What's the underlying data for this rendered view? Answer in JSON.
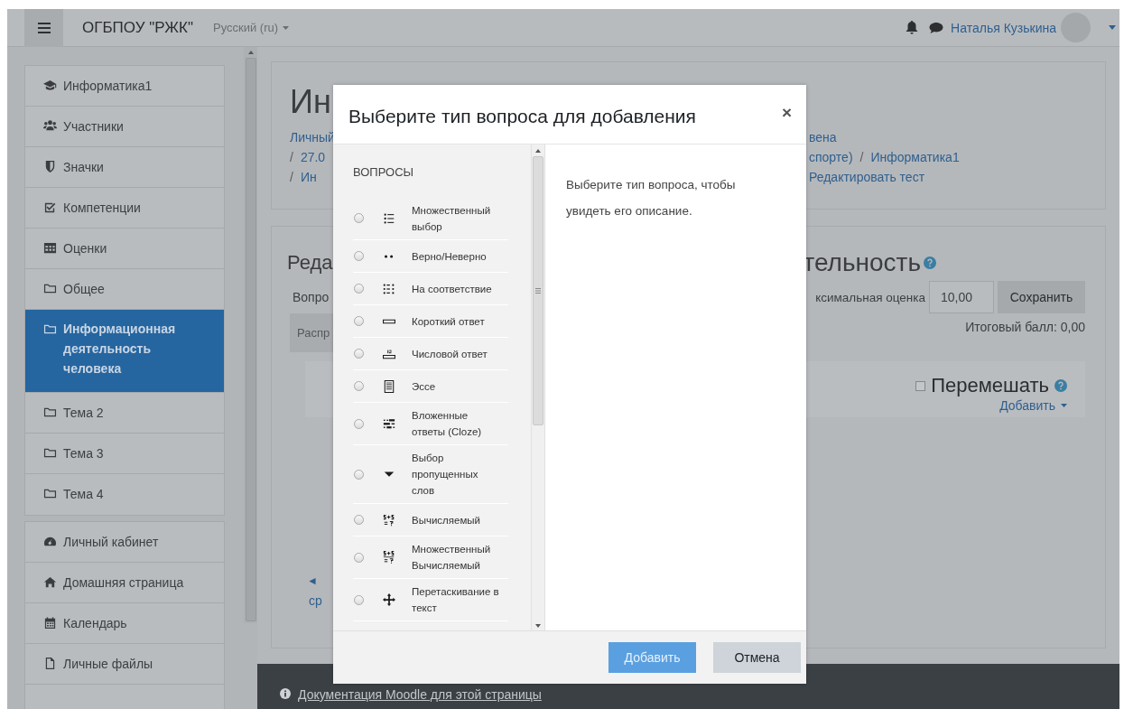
{
  "navbar": {
    "site_name": "ОГБПОУ \"РЖК\"",
    "language": "Русский (ru)",
    "user_name": "Наталья Кузькина"
  },
  "sidebar": {
    "groups": [
      {
        "items": [
          {
            "label": "Информатика1",
            "kind": "course",
            "selected": false
          },
          {
            "label": "Участники",
            "kind": "participants",
            "selected": false
          },
          {
            "label": "Значки",
            "kind": "badges",
            "selected": false
          },
          {
            "label": "Компетенции",
            "kind": "competencies",
            "selected": false
          },
          {
            "label": "Оценки",
            "kind": "grades",
            "selected": false
          },
          {
            "label": "Общее",
            "kind": "section",
            "selected": false
          },
          {
            "label": "Информационная деятельность человека",
            "kind": "section",
            "selected": true
          },
          {
            "label": "Тема 2",
            "kind": "section",
            "selected": false
          },
          {
            "label": "Тема 3",
            "kind": "section",
            "selected": false
          },
          {
            "label": "Тема 4",
            "kind": "section",
            "selected": false
          }
        ]
      },
      {
        "items": [
          {
            "label": "Личный кабинет",
            "kind": "dashboard",
            "selected": false
          },
          {
            "label": "Домашняя страница",
            "kind": "home",
            "selected": false
          },
          {
            "label": "Календарь",
            "kind": "calendar",
            "selected": false
          },
          {
            "label": "Личные файлы",
            "kind": "files",
            "selected": false
          }
        ]
      }
    ]
  },
  "header_card": {
    "title_fragment": "Ин",
    "breadcrumb_rows": [
      {
        "left": [
          {
            "text": "Личный",
            "kind": "link"
          }
        ],
        "right": [
          {
            "text": "вена",
            "kind": "link"
          }
        ]
      },
      {
        "left": [
          {
            "text": "/",
            "kind": "separator"
          },
          {
            "text": "27.0",
            "kind": "link"
          }
        ],
        "right": [
          {
            "text": "спорте)",
            "kind": "link"
          },
          {
            "text": "/",
            "kind": "separator"
          },
          {
            "text": "Информатика1",
            "kind": "link"
          }
        ]
      },
      {
        "left": [
          {
            "text": "/",
            "kind": "separator"
          },
          {
            "text": "Ин",
            "kind": "link"
          }
        ],
        "right": [
          {
            "text": "Редактировать тест",
            "kind": "link"
          }
        ]
      }
    ]
  },
  "main_card": {
    "title_fragment_left": "Реда",
    "title_fragment_right": "тельность",
    "questions_fragment": "Вопро",
    "repaginate_fragment": "Распр",
    "max_grade_label": "ксимальная оценка",
    "max_grade_value": "10,00",
    "save_button": "Сохранить",
    "total_marks": "Итоговый балл: 0,00",
    "shuffle": {
      "label": "Перемешать",
      "checked": false
    },
    "add_menu": "Добавить",
    "prev_link_fragment": "◄",
    "link_fragment": "ср"
  },
  "footer": {
    "doc_link": "Документация Moodle для этой страницы"
  },
  "modal": {
    "title": "Выберите тип вопроса для добавления",
    "close": "×",
    "list_heading": "ВОПРОСЫ",
    "items": [
      {
        "label": "Множественный выбор",
        "kind": "multichoice",
        "selected": false
      },
      {
        "label": "Верно/Неверно",
        "kind": "truefalse",
        "selected": false
      },
      {
        "label": "На соответствие",
        "kind": "match",
        "selected": false
      },
      {
        "label": "Короткий ответ",
        "kind": "shortanswer",
        "selected": false
      },
      {
        "label": "Числовой ответ",
        "kind": "numerical",
        "selected": false
      },
      {
        "label": "Эссе",
        "kind": "essay",
        "selected": false
      },
      {
        "label": "Вложенные ответы (Cloze)",
        "kind": "multianswer",
        "selected": false
      },
      {
        "label": "Выбор пропущенных слов",
        "kind": "gapselect",
        "selected": false
      },
      {
        "label": "Вычисляемый",
        "kind": "calculated",
        "selected": false
      },
      {
        "label": "Множественный Вычисляемый",
        "kind": "calculatedmulti",
        "selected": false
      },
      {
        "label": "Перетаскивание в текст",
        "kind": "ddwtos",
        "selected": false
      }
    ],
    "description": "Выберите тип вопроса, чтобы увидеть его описание.",
    "buttons": [
      {
        "label": "Добавить",
        "kind": "primary",
        "disabled": true
      },
      {
        "label": "Отмена",
        "kind": "secondary",
        "disabled": false
      }
    ]
  }
}
